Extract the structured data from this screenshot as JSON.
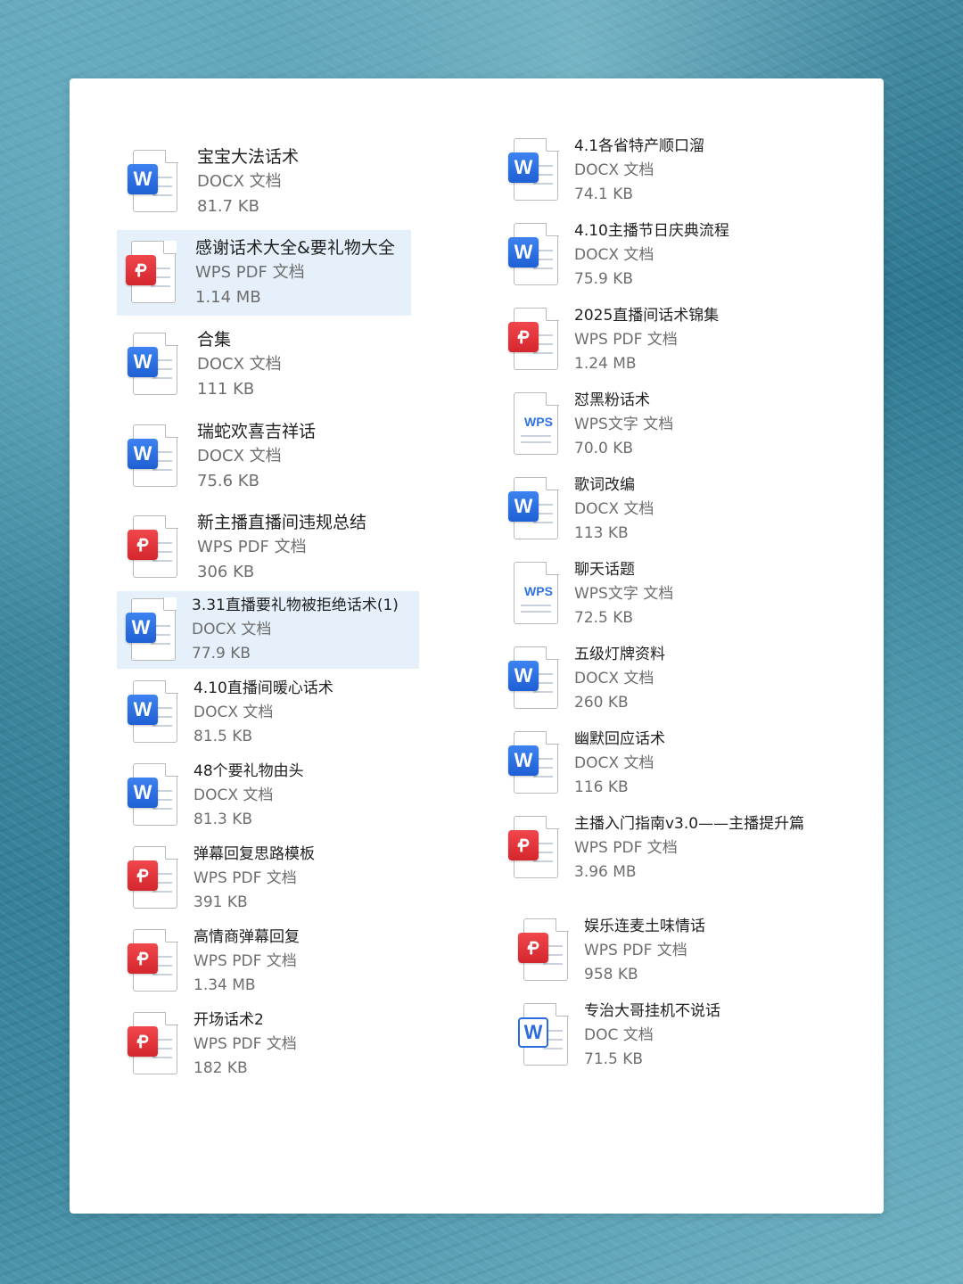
{
  "files": {
    "left": [
      {
        "name": "宝宝大法话术",
        "type": "DOCX 文档",
        "size": "81.7 KB",
        "icon": "word-icon"
      },
      {
        "name": "感谢话术大全&要礼物大全",
        "type": "WPS PDF 文档",
        "size": "1.14 MB",
        "icon": "pdf-icon"
      },
      {
        "name": "合集",
        "type": "DOCX 文档",
        "size": "111 KB",
        "icon": "word-icon"
      },
      {
        "name": "瑞蛇欢喜吉祥话",
        "type": "DOCX 文档",
        "size": "75.6 KB",
        "icon": "word-icon"
      },
      {
        "name": "新主播直播间违规总结",
        "type": "WPS PDF 文档",
        "size": "306 KB",
        "icon": "pdf-icon"
      },
      {
        "name": "3.31直播要礼物被拒绝话术(1)",
        "type": "DOCX 文档",
        "size": "77.9 KB",
        "icon": "word-icon"
      },
      {
        "name": "4.10直播间暖心话术",
        "type": "DOCX 文档",
        "size": "81.5 KB",
        "icon": "word-icon"
      },
      {
        "name": "48个要礼物由头",
        "type": "DOCX 文档",
        "size": "81.3 KB",
        "icon": "word-icon"
      },
      {
        "name": "弹幕回复思路模板",
        "type": "WPS PDF 文档",
        "size": "391 KB",
        "icon": "pdf-icon"
      },
      {
        "name": "高情商弹幕回复",
        "type": "WPS PDF 文档",
        "size": "1.34 MB",
        "icon": "pdf-icon"
      },
      {
        "name": "开场话术2",
        "type": "WPS PDF 文档",
        "size": "182 KB",
        "icon": "pdf-icon"
      }
    ],
    "right": [
      {
        "name": "4.1各省特产顺口溜",
        "type": "DOCX 文档",
        "size": "74.1 KB",
        "icon": "word-icon"
      },
      {
        "name": "4.10主播节日庆典流程",
        "type": "DOCX 文档",
        "size": "75.9 KB",
        "icon": "word-icon"
      },
      {
        "name": "2025直播间话术锦集",
        "type": "WPS PDF 文档",
        "size": "1.24 MB",
        "icon": "pdf-icon"
      },
      {
        "name": "怼黑粉话术",
        "type": "WPS文字 文档",
        "size": "70.0 KB",
        "icon": "wps-writer-icon"
      },
      {
        "name": "歌词改编",
        "type": "DOCX 文档",
        "size": "113 KB",
        "icon": "word-icon"
      },
      {
        "name": "聊天话题",
        "type": "WPS文字 文档",
        "size": "72.5 KB",
        "icon": "wps-writer-icon"
      },
      {
        "name": "五级灯牌资料",
        "type": "DOCX 文档",
        "size": "260 KB",
        "icon": "word-icon"
      },
      {
        "name": "幽默回应话术",
        "type": "DOCX 文档",
        "size": "116 KB",
        "icon": "word-icon"
      },
      {
        "name": "主播入门指南v3.0——主播提升篇",
        "type": "WPS PDF 文档",
        "size": "3.96 MB",
        "icon": "pdf-icon"
      },
      {
        "name": "娱乐连麦土味情话",
        "type": "WPS PDF 文档",
        "size": "958 KB",
        "icon": "pdf-icon"
      },
      {
        "name": "专治大哥挂机不说话",
        "type": "DOC 文档",
        "size": "71.5 KB",
        "icon": "doc-icon"
      }
    ],
    "badge_letters": {
      "word": "W",
      "wps": "WPS"
    }
  },
  "colors": {
    "word_blue": "#1f5fd4",
    "pdf_red": "#d4262d",
    "selection": "#e5f0fb"
  }
}
